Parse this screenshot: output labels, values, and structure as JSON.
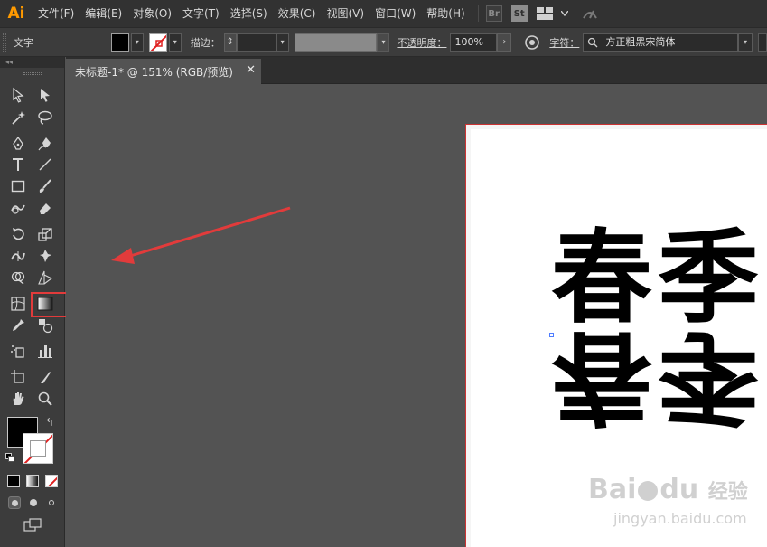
{
  "app": {
    "logo": "Ai"
  },
  "menubar": {
    "items": [
      "文件(F)",
      "编辑(E)",
      "对象(O)",
      "文字(T)",
      "选择(S)",
      "效果(C)",
      "视图(V)",
      "窗口(W)",
      "帮助(H)"
    ],
    "bridge_label": "Br",
    "stock_label": "St"
  },
  "controlbar": {
    "tool_label": "文字",
    "stroke_label": "描边：",
    "opacity_label": "不透明度：",
    "opacity_value": "100%",
    "character_label": "字符：",
    "font_value": "方正粗黑宋简体"
  },
  "tabs": [
    {
      "title": "未标题-1* @ 151% (RGB/预览)"
    }
  ],
  "canvas": {
    "glyphs": [
      "春",
      "季"
    ],
    "reflected_glyphs": [
      "春",
      "季"
    ],
    "watermark_brand": "Bai",
    "watermark_du": "du",
    "watermark_exp": "经验",
    "watermark_url": "jingyan.baidu.com"
  },
  "colors": {
    "accent_red": "#e23b3b",
    "baseline_blue": "#4f7dff",
    "logo_orange": "#ff9a00"
  }
}
